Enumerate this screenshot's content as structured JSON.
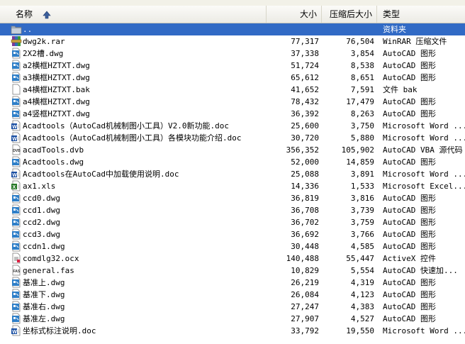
{
  "columns": {
    "name": "名称",
    "size": "大小",
    "packed": "压缩后大小",
    "type": "类型"
  },
  "colors": {
    "selection": "#316ac5",
    "header_bg": "#ecebe5",
    "dwg_icon": "#2f7fc8",
    "doc_icon": "#1a4fa3",
    "xls_icon": "#2a7a2a",
    "folder": "#f4d46b"
  },
  "files": [
    {
      "name": "..",
      "size": "",
      "packed": "",
      "type": "资料夹",
      "icon": "folder-up-icon",
      "selected": true
    },
    {
      "name": "dwg2k.rar",
      "size": "77,317",
      "packed": "76,504",
      "type": "WinRAR 压缩文件",
      "icon": "rar-icon"
    },
    {
      "name": "2X2槽.dwg",
      "size": "37,338",
      "packed": "3,854",
      "type": "AutoCAD 图形",
      "icon": "dwg-icon"
    },
    {
      "name": "a2横框HZTXT.dwg",
      "size": "51,724",
      "packed": "8,538",
      "type": "AutoCAD 图形",
      "icon": "dwg-icon"
    },
    {
      "name": "a3横框HZTXT.dwg",
      "size": "65,612",
      "packed": "8,651",
      "type": "AutoCAD 图形",
      "icon": "dwg-icon"
    },
    {
      "name": "a4横框HZTXT.bak",
      "size": "41,652",
      "packed": "7,591",
      "type": "文件 bak",
      "icon": "blank-file-icon"
    },
    {
      "name": "a4横框HZTXT.dwg",
      "size": "78,432",
      "packed": "17,479",
      "type": "AutoCAD 图形",
      "icon": "dwg-icon"
    },
    {
      "name": "a4竖框HZTXT.dwg",
      "size": "36,392",
      "packed": "8,263",
      "type": "AutoCAD 图形",
      "icon": "dwg-icon"
    },
    {
      "name": "Acadtools（AutoCad机械制图小工具）V2.0新功能.doc",
      "size": "25,600",
      "packed": "3,750",
      "type": "Microsoft Word ...",
      "icon": "doc-icon"
    },
    {
      "name": "Acadtools（AutoCad机械制图小工具）各模块功能介绍.doc",
      "size": "30,720",
      "packed": "5,880",
      "type": "Microsoft Word ...",
      "icon": "doc-icon"
    },
    {
      "name": "acadTools.dvb",
      "size": "356,352",
      "packed": "105,902",
      "type": "AutoCAD VBA 源代码",
      "icon": "dvb-icon"
    },
    {
      "name": "Acadtools.dwg",
      "size": "52,000",
      "packed": "14,859",
      "type": "AutoCAD 图形",
      "icon": "dwg-icon"
    },
    {
      "name": "Acadtools在AutoCad中加载使用说明.doc",
      "size": "25,088",
      "packed": "3,891",
      "type": "Microsoft Word ...",
      "icon": "doc-icon"
    },
    {
      "name": "ax1.xls",
      "size": "14,336",
      "packed": "1,533",
      "type": "Microsoft Excel...",
      "icon": "xls-icon"
    },
    {
      "name": "ccd0.dwg",
      "size": "36,819",
      "packed": "3,816",
      "type": "AutoCAD 图形",
      "icon": "dwg-icon"
    },
    {
      "name": "ccd1.dwg",
      "size": "36,708",
      "packed": "3,739",
      "type": "AutoCAD 图形",
      "icon": "dwg-icon"
    },
    {
      "name": "ccd2.dwg",
      "size": "36,702",
      "packed": "3,759",
      "type": "AutoCAD 图形",
      "icon": "dwg-icon"
    },
    {
      "name": "ccd3.dwg",
      "size": "36,692",
      "packed": "3,766",
      "type": "AutoCAD 图形",
      "icon": "dwg-icon"
    },
    {
      "name": "ccdn1.dwg",
      "size": "30,448",
      "packed": "4,585",
      "type": "AutoCAD 图形",
      "icon": "dwg-icon"
    },
    {
      "name": "comdlg32.ocx",
      "size": "140,488",
      "packed": "55,447",
      "type": "ActiveX 控件",
      "icon": "ocx-icon"
    },
    {
      "name": "general.fas",
      "size": "10,829",
      "packed": "5,554",
      "type": "AutoCAD 快速加...",
      "icon": "fas-icon"
    },
    {
      "name": "基准上.dwg",
      "size": "26,219",
      "packed": "4,319",
      "type": "AutoCAD 图形",
      "icon": "dwg-icon"
    },
    {
      "name": "基准下.dwg",
      "size": "26,084",
      "packed": "4,123",
      "type": "AutoCAD 图形",
      "icon": "dwg-icon"
    },
    {
      "name": "基准右.dwg",
      "size": "27,247",
      "packed": "4,383",
      "type": "AutoCAD 图形",
      "icon": "dwg-icon"
    },
    {
      "name": "基准左.dwg",
      "size": "27,907",
      "packed": "4,527",
      "type": "AutoCAD 图形",
      "icon": "dwg-icon"
    },
    {
      "name": "坐标式标注说明.doc",
      "size": "33,792",
      "packed": "19,550",
      "type": "Microsoft Word ...",
      "icon": "doc-icon"
    }
  ]
}
